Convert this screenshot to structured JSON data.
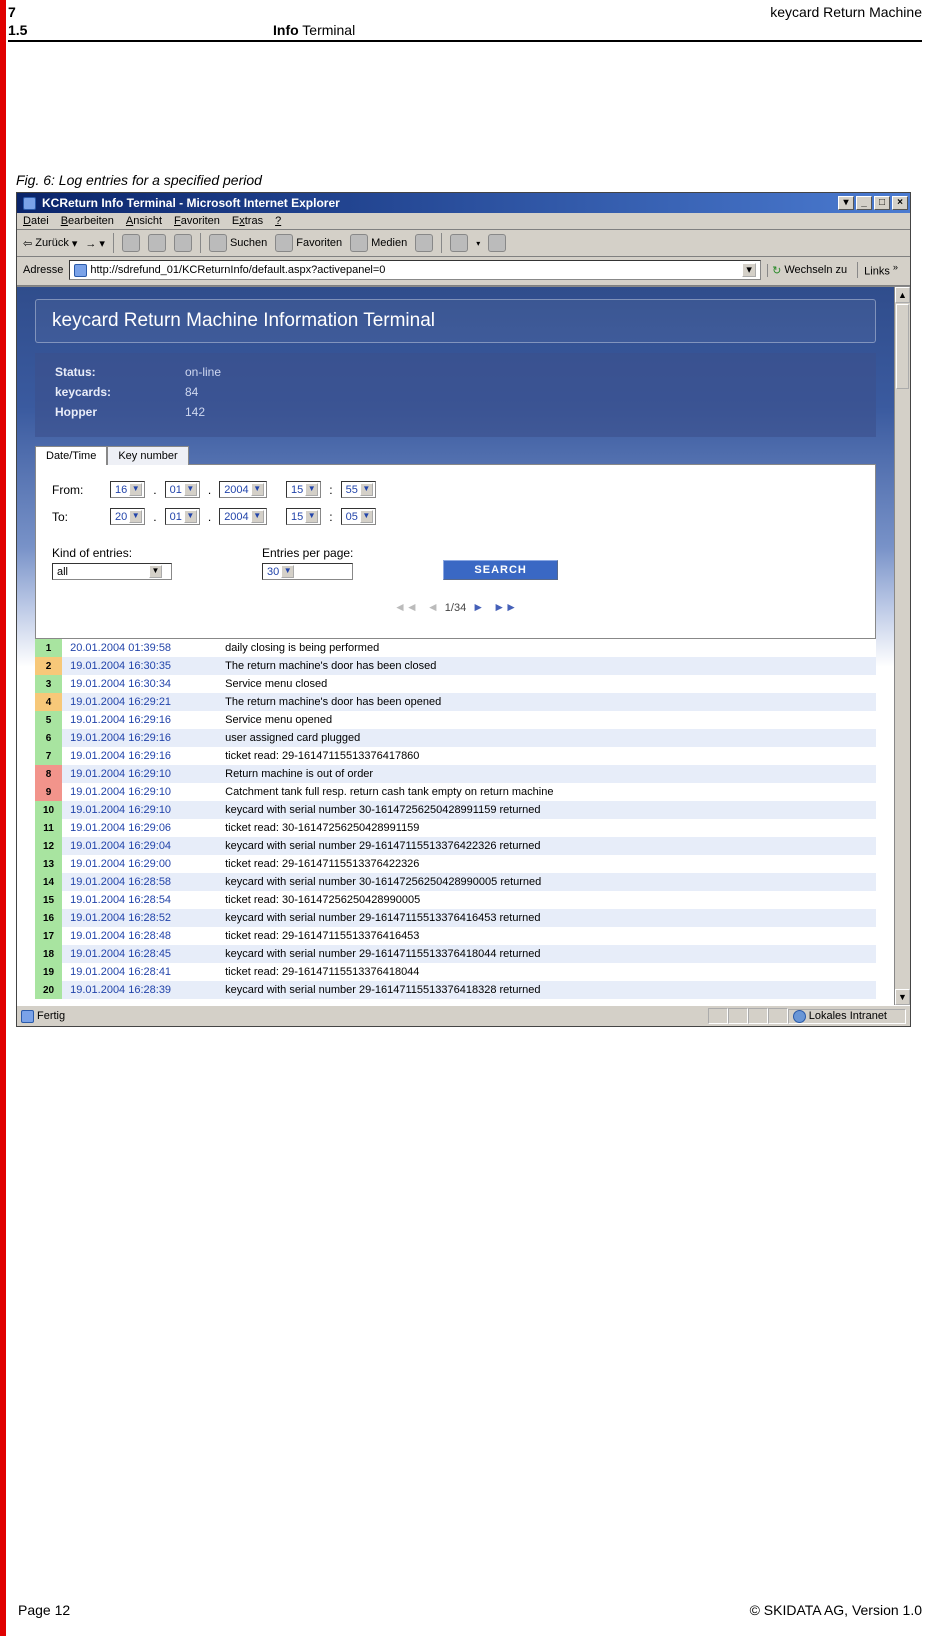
{
  "header": {
    "page_num_top": "7",
    "doc_title": "keycard Return Machine",
    "sect_num": "1.5",
    "sect_bold": "Info",
    "sect_rest": " Terminal"
  },
  "figure_caption": "Fig. 6: Log entries for a specified period",
  "ie": {
    "title": "KCReturn Info Terminal - Microsoft Internet Explorer",
    "menu": [
      "Datei",
      "Bearbeiten",
      "Ansicht",
      "Favoriten",
      "Extras",
      "?"
    ],
    "toolbar": {
      "back": "Zurück",
      "search": "Suchen",
      "favs": "Favoriten",
      "media": "Medien"
    },
    "addr_label": "Adresse",
    "addr_url": "http://sdrefund_01/KCReturnInfo/default.aspx?activepanel=0",
    "go": "Wechseln zu",
    "links": "Links"
  },
  "web": {
    "title": "keycard Return Machine Information Terminal",
    "status": [
      {
        "label": "Status:",
        "value": "on-line"
      },
      {
        "label": "keycards:",
        "value": "84"
      },
      {
        "label": "Hopper",
        "value": "142"
      }
    ],
    "tabs": [
      "Date/Time",
      "Key number"
    ],
    "labels": {
      "from": "From:",
      "to": "To:",
      "kind": "Kind of entries:",
      "epp": "Entries per page:",
      "search": "SEARCH"
    },
    "from": {
      "d": "16",
      "m": "01",
      "y": "2004",
      "h": "15",
      "mi": "55"
    },
    "to": {
      "d": "20",
      "m": "01",
      "y": "2004",
      "h": "15",
      "mi": "05"
    },
    "kind_value": "all",
    "per_page": "30",
    "pager": "1/34",
    "rows": [
      {
        "n": "1",
        "c": "green",
        "ts": "20.01.2004 01:39:58",
        "msg": "daily closing is being performed"
      },
      {
        "n": "2",
        "c": "orange",
        "ts": "19.01.2004 16:30:35",
        "msg": "The return machine's door has been closed"
      },
      {
        "n": "3",
        "c": "green",
        "ts": "19.01.2004 16:30:34",
        "msg": "Service menu closed"
      },
      {
        "n": "4",
        "c": "orange",
        "ts": "19.01.2004 16:29:21",
        "msg": "The return machine's door has been opened"
      },
      {
        "n": "5",
        "c": "green",
        "ts": "19.01.2004 16:29:16",
        "msg": "Service menu opened"
      },
      {
        "n": "6",
        "c": "green",
        "ts": "19.01.2004 16:29:16",
        "msg": "user assigned card plugged"
      },
      {
        "n": "7",
        "c": "green",
        "ts": "19.01.2004 16:29:16",
        "msg": "ticket read: 29-16147115513376417860"
      },
      {
        "n": "8",
        "c": "red",
        "ts": "19.01.2004 16:29:10",
        "msg": "Return machine is out of order"
      },
      {
        "n": "9",
        "c": "red",
        "ts": "19.01.2004 16:29:10",
        "msg": "Catchment tank full resp. return cash tank empty on return machine"
      },
      {
        "n": "10",
        "c": "green",
        "ts": "19.01.2004 16:29:10",
        "msg": "keycard with serial number 30-16147256250428991159 returned"
      },
      {
        "n": "11",
        "c": "green",
        "ts": "19.01.2004 16:29:06",
        "msg": "ticket read: 30-16147256250428991159"
      },
      {
        "n": "12",
        "c": "green",
        "ts": "19.01.2004 16:29:04",
        "msg": "keycard with serial number 29-16147115513376422326 returned"
      },
      {
        "n": "13",
        "c": "green",
        "ts": "19.01.2004 16:29:00",
        "msg": "ticket read: 29-16147115513376422326"
      },
      {
        "n": "14",
        "c": "green",
        "ts": "19.01.2004 16:28:58",
        "msg": "keycard with serial number 30-16147256250428990005 returned"
      },
      {
        "n": "15",
        "c": "green",
        "ts": "19.01.2004 16:28:54",
        "msg": "ticket read: 30-16147256250428990005"
      },
      {
        "n": "16",
        "c": "green",
        "ts": "19.01.2004 16:28:52",
        "msg": "keycard with serial number 29-16147115513376416453 returned"
      },
      {
        "n": "17",
        "c": "green",
        "ts": "19.01.2004 16:28:48",
        "msg": "ticket read: 29-16147115513376416453"
      },
      {
        "n": "18",
        "c": "green",
        "ts": "19.01.2004 16:28:45",
        "msg": "keycard with serial number 29-16147115513376418044 returned"
      },
      {
        "n": "19",
        "c": "green",
        "ts": "19.01.2004 16:28:41",
        "msg": "ticket read: 29-16147115513376418044"
      },
      {
        "n": "20",
        "c": "green",
        "ts": "19.01.2004 16:28:39",
        "msg": "keycard with serial number 29-16147115513376418328 returned"
      }
    ]
  },
  "statusbar": {
    "ready": "Fertig",
    "zone": "Lokales Intranet"
  },
  "footer": {
    "left": "Page 12",
    "right": "© SKIDATA AG, Version 1.0"
  }
}
